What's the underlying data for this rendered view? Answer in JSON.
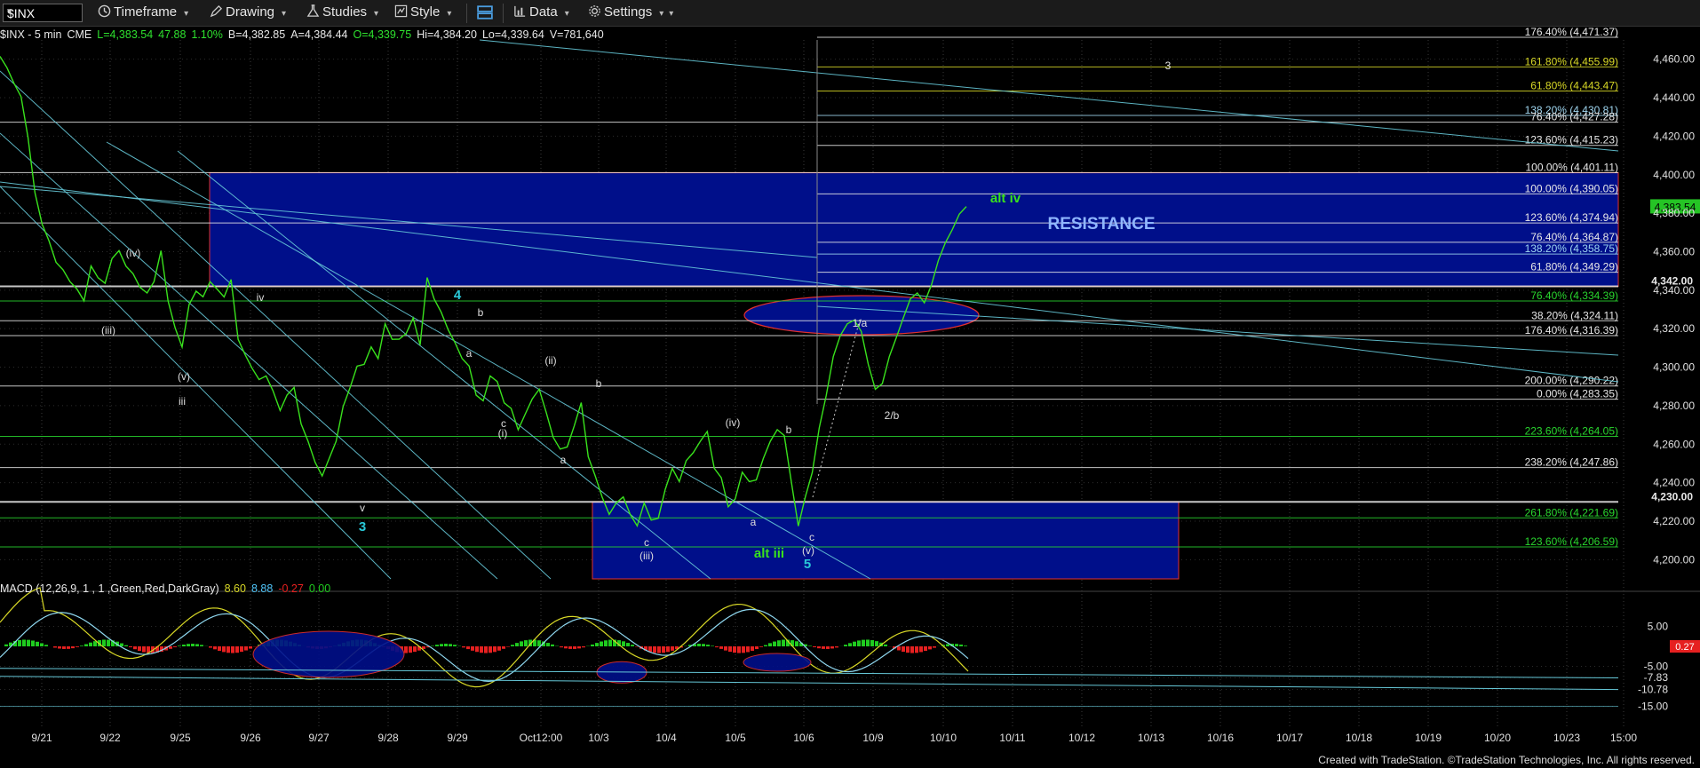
{
  "toolbar": {
    "symbol": "$INX",
    "items": [
      "Timeframe",
      "Drawing",
      "Studies",
      "Style",
      "Data",
      "Settings"
    ]
  },
  "info": {
    "symbol": "$INX - 5 min",
    "exchange": "CME",
    "last": "L=4,383.54",
    "change": "47.88",
    "pct": "1.10%",
    "bid": "B=4,382.85",
    "ask": "A=4,384.44",
    "open": "O=4,339.75",
    "high": "Hi=4,384.20",
    "low": "Lo=4,339.64",
    "volume": "V=781,640"
  },
  "macd": {
    "label": "MACD (12,26,9, 1 , 1 ,Green,Red,DarkGray)",
    "v1": "8.60",
    "v2": "8.88",
    "v3": "-0.27",
    "v4": "0.00"
  },
  "footer": "Created with TradeStation. ©TradeStation Technologies, Inc. All rights reserved.",
  "colors": {
    "price": "#39e21c",
    "resistance_fill": "#000f8a",
    "fib_green": "#29d62e",
    "fib_yellow": "#d8d826",
    "fib_white": "#e8e8e8",
    "fib_cyan": "#9fd6f0",
    "trend": "#66c8d8",
    "macd_up": "#1fcc1f",
    "macd_down": "#e62020"
  },
  "chart_data": {
    "type": "line",
    "title": "",
    "ylim": [
      4190,
      4470
    ],
    "y_ticks": [
      "4,460.00",
      "4,440.00",
      "4,420.00",
      "4,400.00",
      "4,380.00",
      "4,360.00",
      "4,340.00",
      "4,320.00",
      "4,300.00",
      "4,280.00",
      "4,260.00",
      "4,240.00",
      "4,220.00",
      "4,200.00"
    ],
    "x_ticks": [
      "9/21",
      "9/22",
      "9/25",
      "9/26",
      "9/27",
      "9/28",
      "9/29",
      "Oct12:00",
      "10/3",
      "10/4",
      "10/5",
      "10/6",
      "10/9",
      "10/10",
      "10/11",
      "10/12",
      "10/13",
      "10/16",
      "10/17",
      "10/18",
      "10/19",
      "10/20",
      "10/23",
      "15:00"
    ],
    "series": [
      {
        "values": [
          4462,
          4455,
          4448,
          4440,
          4420,
          4390,
          4375,
          4365,
          4355,
          4350,
          4345,
          4340,
          4335,
          4352,
          4347,
          4343,
          4357,
          4360,
          4353,
          4348,
          4342,
          4338,
          4345,
          4360,
          4335,
          4320,
          4311,
          4332,
          4340,
          4336,
          4345,
          4340,
          4337,
          4345,
          4315,
          4306,
          4300,
          4293,
          4296,
          4287,
          4278,
          4285,
          4290,
          4270,
          4262,
          4250,
          4244,
          4252,
          4262,
          4279,
          4290,
          4300,
          4302,
          4310,
          4305,
          4322,
          4315,
          4314,
          4318,
          4325,
          4312,
          4346,
          4336,
          4328,
          4320,
          4312,
          4305,
          4300,
          4286,
          4282,
          4296,
          4292,
          4282,
          4278,
          4268,
          4275,
          4284,
          4288,
          4277,
          4263,
          4258,
          4258,
          4270,
          4281,
          4254,
          4243,
          4233,
          4223,
          4230,
          4232,
          4224,
          4217,
          4230,
          4220,
          4222,
          4236,
          4248,
          4240,
          4252,
          4255,
          4262,
          4266,
          4248,
          4242,
          4228,
          4231,
          4246,
          4240,
          4242,
          4252,
          4262,
          4267,
          4265,
          4240,
          4218,
          4232,
          4246,
          4268,
          4286,
          4305,
          4317,
          4322,
          4325,
          4318,
          4302,
          4288,
          4292,
          4305,
          4316,
          4325,
          4336,
          4338,
          4334,
          4342,
          4356,
          4364,
          4372,
          4379,
          4384
        ]
      }
    ],
    "horizontal_levels": [
      {
        "label": "176.40% (4,471.37)",
        "value": 4471.37
      },
      {
        "label": "161.80% (4,455.99)",
        "value": 4455.99
      },
      {
        "label": "61.80% (4,443.47)",
        "value": 4443.47
      },
      {
        "label": "138.20% (4,430.81)",
        "value": 4430.81
      },
      {
        "label": "76.40% (4,427.28)",
        "value": 4427.28
      },
      {
        "label": "123.60% (4,415.23)",
        "value": 4415.23
      },
      {
        "label": "100.00% (4,401.11)",
        "value": 4401.11
      },
      {
        "label": "100.00% (4,390.05)",
        "value": 4390.05
      },
      {
        "label": "123.60% (4,374.94)",
        "value": 4374.94
      },
      {
        "label": "76.40% (4,364.87)",
        "value": 4364.87
      },
      {
        "label": "138.20% (4,358.75)",
        "value": 4358.75
      },
      {
        "label": "61.80% (4,349.29)",
        "value": 4349.29
      },
      {
        "label": "4,342.00",
        "value": 4342.0
      },
      {
        "label": "76.40% (4,334.39)",
        "value": 4334.39
      },
      {
        "label": "38.20% (4,324.11)",
        "value": 4324.11
      },
      {
        "label": "176.40% (4,316.39)",
        "value": 4316.39
      },
      {
        "label": "200.00% (4,290.22)",
        "value": 4290.22
      },
      {
        "label": "0.00% (4,283.35)",
        "value": 4283.35
      },
      {
        "label": "223.60% (4,264.05)",
        "value": 4264.05
      },
      {
        "label": "238.20% (4,247.86)",
        "value": 4247.86
      },
      {
        "label": "4,230.00",
        "value": 4230.0
      },
      {
        "label": "261.80% (4,221.69)",
        "value": 4221.69
      },
      {
        "label": "123.60% (4,206.59)",
        "value": 4206.59
      }
    ],
    "annotations": {
      "resistance": "RESISTANCE",
      "alt_iv": "alt iv",
      "alt_iii": "alt iii",
      "wave_3_top": "3",
      "current_price_tag": "4,383.54",
      "macd_tag": "0.27",
      "macd_levels": [
        "5.00",
        "-5.00",
        "-7.83",
        "-10.78",
        "-15.00"
      ],
      "wave_labels": [
        "(iv)",
        "(iii)",
        "(v)",
        "iii",
        "iv",
        "4",
        "b",
        "a",
        "(i)",
        "c",
        "(ii)",
        "a",
        "b",
        "v",
        "3",
        "c",
        "(iii)",
        "(iv)",
        "a",
        "b",
        "c",
        "(v)",
        "5",
        "1/a",
        "2/b"
      ]
    }
  }
}
